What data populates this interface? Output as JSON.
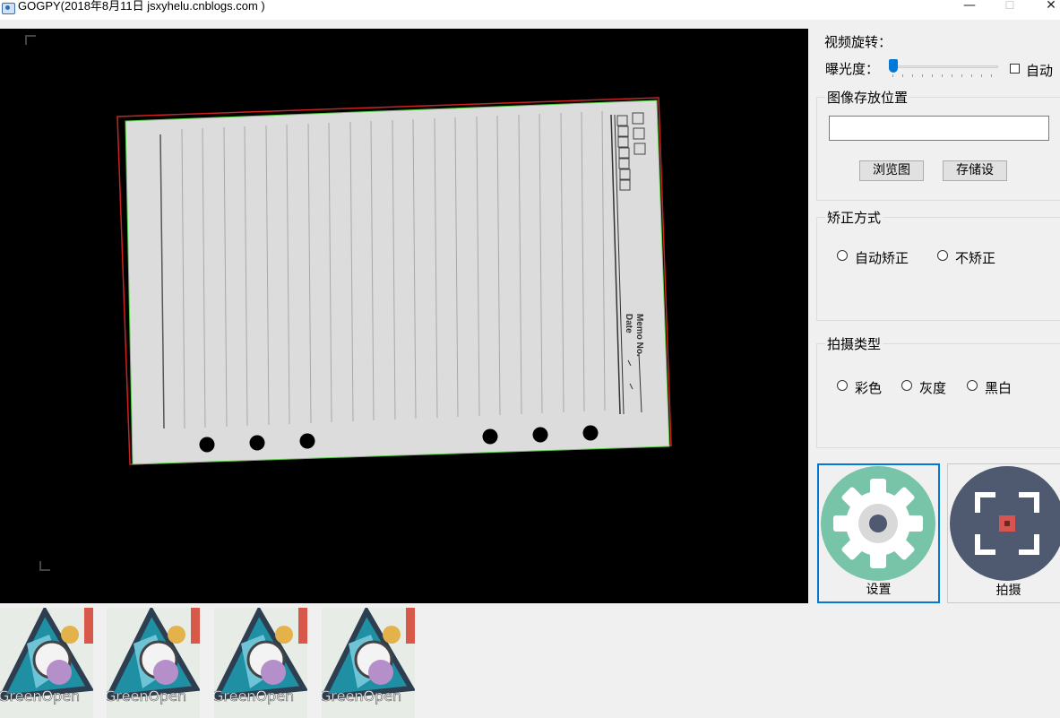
{
  "window": {
    "title": "GOGPY(2018年8月11日 jsxyhelu.cnblogs.com )",
    "minimize_glyph": "—",
    "maximize_glyph": "☐",
    "close_glyph": "✕"
  },
  "panel": {
    "video_rotate_label": "视频旋转：",
    "exposure_label": "曝光度：",
    "exposure_value": 0,
    "auto_label": "自动",
    "auto_checked": false,
    "save_location": {
      "title": "图像存放位置",
      "path_value": "",
      "browse_label": "浏览图",
      "store_label": "存储设"
    },
    "correction": {
      "title": "矫正方式",
      "options": [
        "自动矫正",
        "不矫正"
      ],
      "selected": null
    },
    "capture_type": {
      "title": "拍摄类型",
      "options": [
        "彩色",
        "灰度",
        "黑白"
      ],
      "selected": null
    },
    "settings_button": {
      "label": "设置",
      "icon": "gear-icon",
      "color": "#78c4a8"
    },
    "capture_button": {
      "label": "拍摄",
      "icon": "capture-icon",
      "color": "#4f5a70"
    }
  },
  "camera": {
    "paper_texts": [
      "Memo No.",
      "Date"
    ],
    "detect_outline_color": "#cc2222",
    "detect_outline_color2": "#55cc44"
  },
  "thumbnails": {
    "count": 4,
    "watermark": "GreenOpen"
  }
}
